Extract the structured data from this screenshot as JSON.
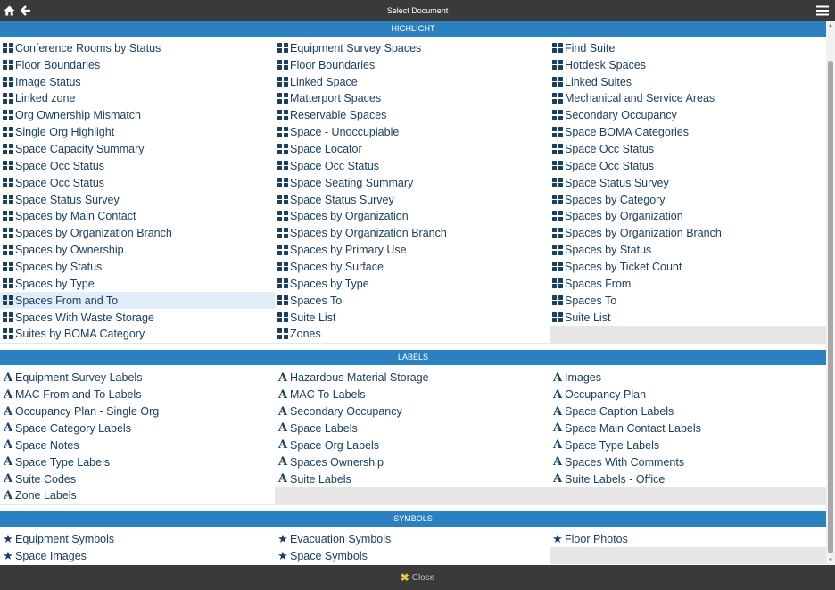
{
  "window": {
    "title": "Select Document"
  },
  "footer": {
    "close_label": "Close"
  },
  "colors": {
    "header": "#2b80bf",
    "topbar": "#3a3a3a",
    "text": "#1c3f60",
    "highlight_row": "#e1eef9"
  },
  "sections": [
    {
      "title": "HIGHLIGHT",
      "icon": "grid-icon",
      "columns": [
        [
          "Conference Rooms by Status",
          "Floor Boundaries",
          "Image Status",
          "Linked zone",
          "Org Ownership Mismatch",
          "Single Org Highlight",
          "Space Capacity Summary",
          "Space Occ Status",
          "Space Occ Status",
          "Space Status Survey",
          "Spaces by Main Contact",
          "Spaces by Organization Branch",
          "Spaces by Ownership",
          "Spaces by Status",
          "Spaces by Type",
          "Spaces From and To",
          "Spaces With Waste Storage",
          "Suites by BOMA Category"
        ],
        [
          "Equipment Survey Spaces",
          "Floor Boundaries",
          "Linked Space",
          "Matterport Spaces",
          "Reservable Spaces",
          "Space - Unoccupiable",
          "Space Locator",
          "Space Occ Status",
          "Space Seating Summary",
          "Space Status Survey",
          "Spaces by Organization",
          "Spaces by Organization Branch",
          "Spaces by Primary Use",
          "Spaces by Surface",
          "Spaces by Type",
          "Spaces To",
          "Suite List",
          "Zones"
        ],
        [
          "Find Suite",
          "Hotdesk Spaces",
          "Linked Suites",
          "Mechanical and Service Areas",
          "Secondary Occupancy",
          "Space BOMA Categories",
          "Space Occ Status",
          "Space Occ Status",
          "Space Status Survey",
          "Spaces by Category",
          "Spaces by Organization",
          "Spaces by Organization Branch",
          "Spaces by Status",
          "Spaces by Ticket Count",
          "Spaces From",
          "Spaces To",
          "Suite List"
        ]
      ]
    },
    {
      "title": "LABELS",
      "icon": "font-icon",
      "columns": [
        [
          "Equipment Survey Labels",
          "MAC From and To Labels",
          "Occupancy Plan - Single Org",
          "Space Category Labels",
          "Space Notes",
          "Space Type Labels",
          "Suite Codes",
          "Zone Labels"
        ],
        [
          "Hazardous Material Storage",
          "MAC To Labels",
          "Secondary Occupancy",
          "Space Labels",
          "Space Org Labels",
          "Spaces Ownership",
          "Suite Labels"
        ],
        [
          "Images",
          "Occupancy Plan",
          "Space Caption Labels",
          "Space Main Contact Labels",
          "Space Type Labels",
          "Spaces With Comments",
          "Suite Labels - Office"
        ]
      ]
    },
    {
      "title": "SYMBOLS",
      "icon": "star-icon",
      "columns": [
        [
          "Equipment Symbols",
          "Space Images"
        ],
        [
          "Evacuation Symbols",
          "Space Symbols"
        ],
        [
          "Floor Photos"
        ]
      ]
    }
  ],
  "highlighted_item": "Spaces From and To"
}
